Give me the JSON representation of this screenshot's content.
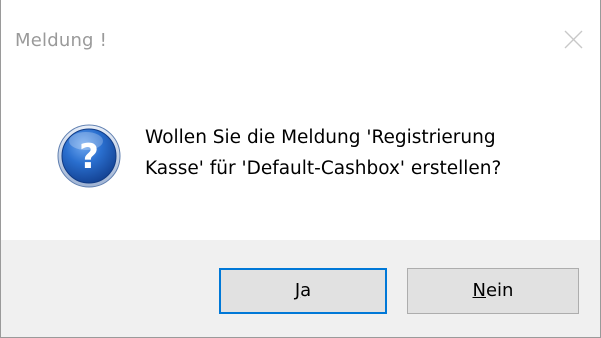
{
  "window": {
    "title": "Meldung !"
  },
  "icons": {
    "dialog": "question-icon",
    "close": "close-icon"
  },
  "message": {
    "line1": "Wollen Sie die Meldung 'Registrierung",
    "line2": "Kasse' für 'Default-Cashbox' erstellen?"
  },
  "buttons": {
    "yes": {
      "mnemonic": "J",
      "rest": "a"
    },
    "no": {
      "mnemonic": "N",
      "rest": "ein"
    }
  },
  "colors": {
    "accent": "#0078d7",
    "icon_blue": "#1c5fb8",
    "button_bar": "#f0f0f0",
    "button_face": "#e1e1e1"
  }
}
